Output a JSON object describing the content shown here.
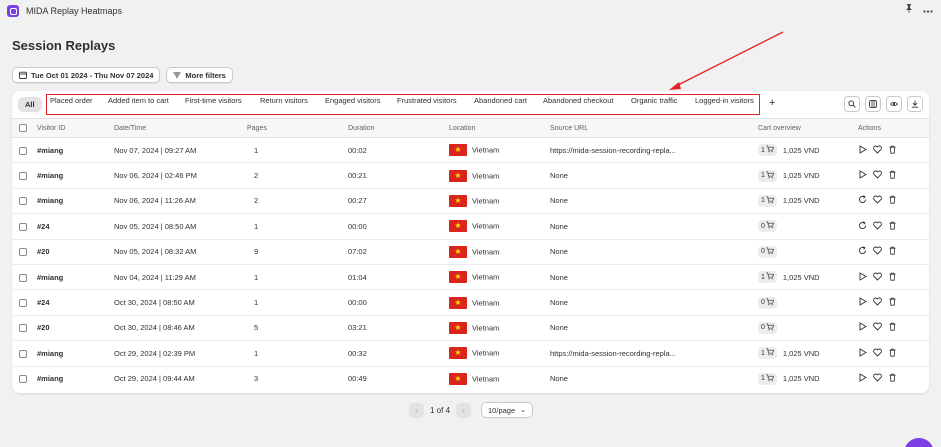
{
  "app": {
    "title": "MIDA Replay Heatmaps"
  },
  "page": {
    "title": "Session Replays"
  },
  "filters": {
    "date_range": "Tue Oct 01 2024 - Thu Nov 07 2024",
    "more_filters": "More filters"
  },
  "tabs": {
    "all": "All",
    "items": [
      "Placed order",
      "Added item to cart",
      "First-time visitors",
      "Return visitors",
      "Engaged visitors",
      "Frustrated visitors",
      "Abandoned cart",
      "Abandoned checkout",
      "Organic traffic",
      "Logged-in visitors"
    ],
    "add": "+"
  },
  "table": {
    "headers": {
      "visitor_id": "Visitor ID",
      "datetime": "Date/Time",
      "pages": "Pages",
      "duration": "Duration",
      "location": "Location",
      "source": "Source URL",
      "cart": "Cart overview",
      "actions": "Actions"
    },
    "rows": [
      {
        "visitor": "#miang",
        "datetime": "Nov 07, 2024 | 09:27 AM",
        "pages": "1",
        "duration": "00:02",
        "country": "Vietnam",
        "source": "https://mida-session-recording-repla...",
        "cart_count": "1",
        "cart_value": "1,025 VND",
        "action": "play"
      },
      {
        "visitor": "#miang",
        "datetime": "Nov 06, 2024 | 02:46 PM",
        "pages": "2",
        "duration": "00:21",
        "country": "Vietnam",
        "source": "None",
        "cart_count": "1",
        "cart_value": "1,025 VND",
        "action": "play"
      },
      {
        "visitor": "#miang",
        "datetime": "Nov 06, 2024 | 11:26 AM",
        "pages": "2",
        "duration": "00:27",
        "country": "Vietnam",
        "source": "None",
        "cart_count": "1",
        "cart_value": "1,025 VND",
        "action": "replay"
      },
      {
        "visitor": "#24",
        "datetime": "Nov 05, 2024 | 08:50 AM",
        "pages": "1",
        "duration": "00:00",
        "country": "Vietnam",
        "source": "None",
        "cart_count": "0",
        "cart_value": "",
        "action": "replay"
      },
      {
        "visitor": "#20",
        "datetime": "Nov 05, 2024 | 08:32 AM",
        "pages": "9",
        "duration": "07:02",
        "country": "Vietnam",
        "source": "None",
        "cart_count": "0",
        "cart_value": "",
        "action": "replay"
      },
      {
        "visitor": "#miang",
        "datetime": "Nov 04, 2024 | 11:29 AM",
        "pages": "1",
        "duration": "01:04",
        "country": "Vietnam",
        "source": "None",
        "cart_count": "1",
        "cart_value": "1,025 VND",
        "action": "play"
      },
      {
        "visitor": "#24",
        "datetime": "Oct 30, 2024 | 08:50 AM",
        "pages": "1",
        "duration": "00:00",
        "country": "Vietnam",
        "source": "None",
        "cart_count": "0",
        "cart_value": "",
        "action": "play"
      },
      {
        "visitor": "#20",
        "datetime": "Oct 30, 2024 | 08:46 AM",
        "pages": "5",
        "duration": "03:21",
        "country": "Vietnam",
        "source": "None",
        "cart_count": "0",
        "cart_value": "",
        "action": "play"
      },
      {
        "visitor": "#miang",
        "datetime": "Oct 29, 2024 | 02:39 PM",
        "pages": "1",
        "duration": "00:32",
        "country": "Vietnam",
        "source": "https://mida-session-recording-repla...",
        "cart_count": "1",
        "cart_value": "1,025 VND",
        "action": "play"
      },
      {
        "visitor": "#miang",
        "datetime": "Oct 29, 2024 | 09:44 AM",
        "pages": "3",
        "duration": "00:49",
        "country": "Vietnam",
        "source": "None",
        "cart_count": "1",
        "cart_value": "1,025 VND",
        "action": "play"
      }
    ]
  },
  "pagination": {
    "text": "1 of 4",
    "per_page": "10/page"
  },
  "colors": {
    "highlight_border": "#e0252b",
    "annotation_arrow": "#e0252b",
    "brand": "#7b3fe4",
    "flag_red": "#da251d",
    "flag_star": "#ffde00"
  }
}
